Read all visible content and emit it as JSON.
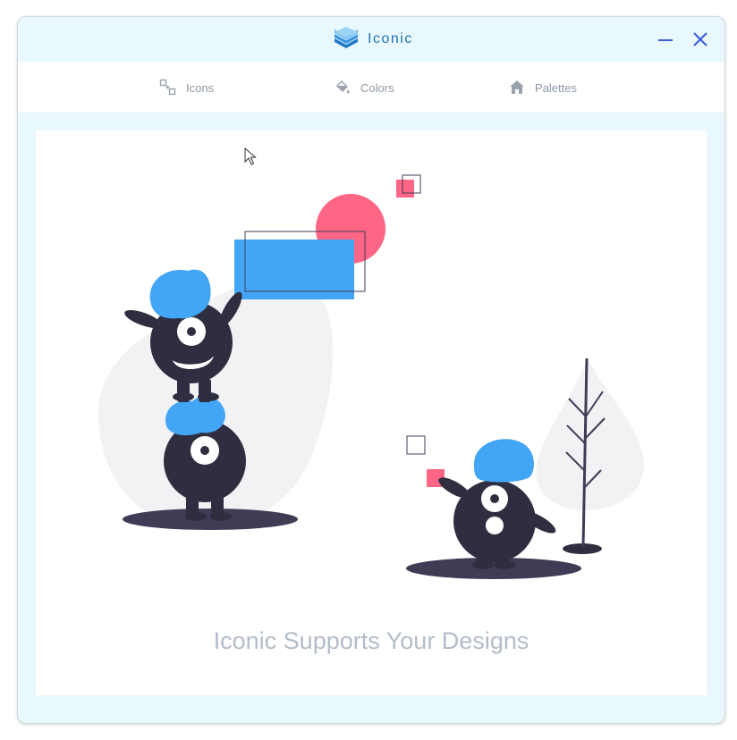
{
  "window": {
    "title": "Iconic",
    "logo_icon": "layers-icon",
    "minimize_icon": "minimize-icon",
    "close_icon": "close-icon",
    "accent_color": "#3b5bdb"
  },
  "nav": {
    "items": [
      {
        "label": "Icons",
        "icon": "shapes-icon"
      },
      {
        "label": "Colors",
        "icon": "paint-bucket-icon"
      },
      {
        "label": "Palettes",
        "icon": "home-icon"
      }
    ]
  },
  "main": {
    "tagline": "Iconic Supports Your Designs",
    "illustration": "monsters-illustration"
  },
  "colors": {
    "background": "#e9f8fd",
    "blue": "#42a5f5",
    "pink": "#ff6584",
    "dark": "#2f2e41",
    "muted": "#b3bcc8"
  }
}
